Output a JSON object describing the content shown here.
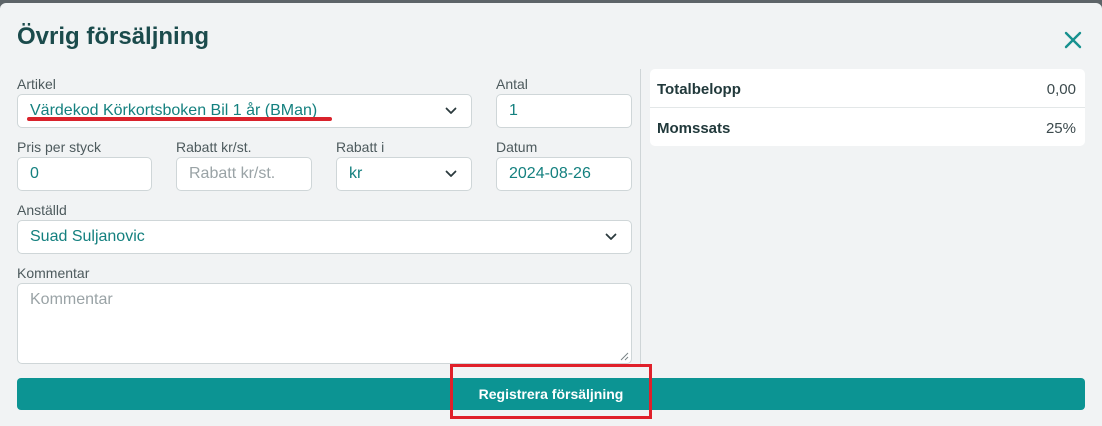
{
  "dialog": {
    "title": "Övrig försäljning",
    "close_icon": "close-icon"
  },
  "form": {
    "artikel": {
      "label": "Artikel",
      "value": "Värdekod Körkortsboken Bil 1 år (BMan)"
    },
    "antal": {
      "label": "Antal",
      "value": "1"
    },
    "pris_per_styck": {
      "label": "Pris per styck",
      "value": "0"
    },
    "rabatt_kr_st": {
      "label": "Rabatt kr/st.",
      "placeholder": "Rabatt kr/st."
    },
    "rabatt_i": {
      "label": "Rabatt i",
      "value": "kr"
    },
    "datum": {
      "label": "Datum",
      "value": "2024-08-26"
    },
    "anstalld": {
      "label": "Anställd",
      "value": "Suad Suljanovic"
    },
    "kommentar": {
      "label": "Kommentar",
      "placeholder": "Kommentar"
    }
  },
  "summary": {
    "total_label": "Totalbelopp",
    "total_value": "0,00",
    "moms_label": "Momssats",
    "moms_value": "25%"
  },
  "submit_label": "Registrera försäljning",
  "colors": {
    "accent": "#0c9493",
    "title": "#1b4b4c",
    "annotation": "#e0202a"
  }
}
